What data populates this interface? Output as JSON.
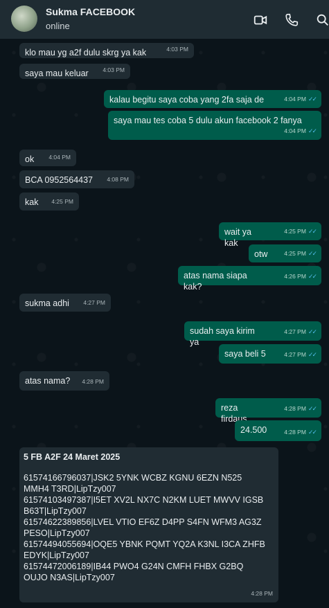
{
  "header": {
    "name": "Sukma FACEBOOK",
    "status": "online"
  },
  "messages": [
    {
      "dir": "in",
      "text": "klo mau yg a2f dulu skrg ya kak",
      "time": "4:03 PM"
    },
    {
      "dir": "in",
      "text": "saya mau keluar",
      "time": "4:03 PM"
    },
    {
      "dir": "out",
      "text": "kalau begitu saya coba yang 2fa saja de",
      "time": "4:04 PM"
    },
    {
      "dir": "out",
      "text": "saya mau tes coba 5 dulu akun facebook 2 fanya",
      "time": "4:04 PM"
    },
    {
      "dir": "in",
      "text": "ok",
      "time": "4:04 PM"
    },
    {
      "dir": "in",
      "text": "BCA 0952564437",
      "time": "4:08 PM"
    },
    {
      "dir": "in",
      "text": "kak",
      "time": "4:25 PM"
    },
    {
      "dir": "out",
      "text": "wait ya kak",
      "time": "4:25 PM"
    },
    {
      "dir": "out",
      "text": "otw",
      "time": "4:25 PM"
    },
    {
      "dir": "out",
      "text": "atas nama siapa kak?",
      "time": "4:26 PM"
    },
    {
      "dir": "in",
      "text": "sukma adhi",
      "time": "4:27 PM"
    },
    {
      "dir": "out",
      "text": "sudah saya kirim ya",
      "time": "4:27 PM"
    },
    {
      "dir": "out",
      "text": "saya beli 5",
      "time": "4:27 PM"
    },
    {
      "dir": "in",
      "text": "atas nama?",
      "time": "4:28 PM"
    },
    {
      "dir": "out",
      "text": "reza firdaus",
      "time": "4:28 PM"
    },
    {
      "dir": "out",
      "text": "24.500",
      "time": "4:28 PM"
    }
  ],
  "final_message": {
    "title": "5 FB A2F 24 Maret 2025",
    "lines": [
      "61574166796037|JSK2 5YNK WCBZ KGNU 6EZN N525",
      "MMH4 T3RD|LipTzy007",
      "61574103497387|I5ET XV2L NX7C N2KM LUET MWVV IGSB",
      "B63T|LipTzy007",
      "61574622389856|LVEL VTIO EF6Z D4PP S4FN WFM3 AG3Z",
      "PESO|LipTzy007",
      "61574494055694|OQE5 YBNK PQMT YQ2A K3NL I3CA ZHFB",
      "EDYK|LipTzy007",
      "61574472006189|IB44 PWO4 G24N CMFH FHBX G2BQ",
      "OUJO N3AS|LipTzy007"
    ],
    "time": "4:28 PM"
  },
  "icons": {
    "video": "video-camera-icon",
    "call": "phone-icon",
    "search": "search-icon",
    "read_receipt": "double-check-icon"
  },
  "colors": {
    "incoming": "#202c33",
    "outgoing": "#005c4b",
    "header": "#1f2c33",
    "ticks": "#53bdeb"
  }
}
